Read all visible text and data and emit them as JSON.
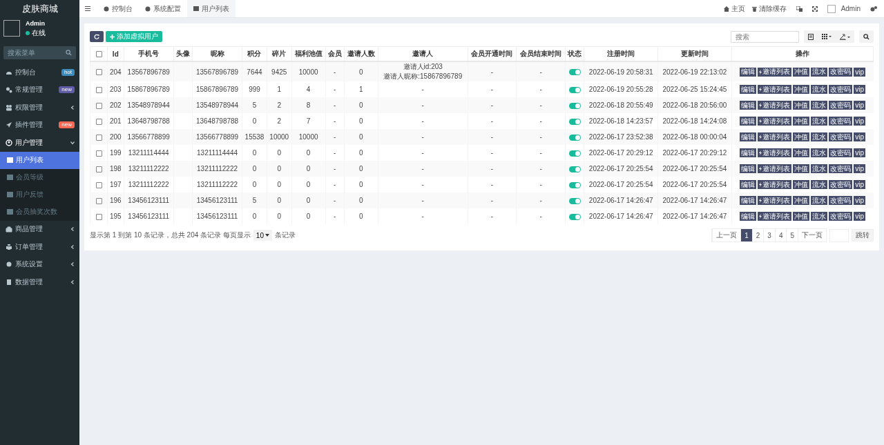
{
  "sidebar": {
    "brand": "皮肤商城",
    "user": {
      "name": "Admin",
      "status": "在线"
    },
    "search": {
      "placeholder": "搜索菜单"
    },
    "items": [
      {
        "label": "控制台",
        "badge": {
          "text": "hot",
          "color": "#3c8dbc"
        }
      },
      {
        "label": "常规管理",
        "badge": {
          "text": "new",
          "color": "#605ca8"
        }
      },
      {
        "label": "权限管理",
        "expanded": false
      },
      {
        "label": "插件管理",
        "badge": {
          "text": "new",
          "color": "#f56954"
        }
      },
      {
        "label": "用户管理",
        "expanded": true,
        "children": [
          {
            "label": "用户列表",
            "selected": true
          },
          {
            "label": "会员等级",
            "selected": false
          },
          {
            "label": "用户反馈",
            "selected": false
          },
          {
            "label": "会员抽奖次数",
            "selected": false
          }
        ]
      },
      {
        "label": "商品管理",
        "expanded": false
      },
      {
        "label": "订单管理",
        "expanded": false
      },
      {
        "label": "系统设置",
        "expanded": false
      },
      {
        "label": "数据管理",
        "expanded": false
      }
    ]
  },
  "header": {
    "tabs": [
      {
        "label": "控制台",
        "selected": false
      },
      {
        "label": "系统配置",
        "selected": false
      },
      {
        "label": "用户列表",
        "selected": true
      }
    ],
    "home": "主页",
    "clear_cache": "清除缓存",
    "user": "Admin"
  },
  "toolbar": {
    "add_button": "添加虚拟用户",
    "search": {
      "placeholder": "搜索"
    }
  },
  "table": {
    "columns": [
      "Id",
      "手机号",
      "头像",
      "昵称",
      "积分",
      "碎片",
      "福利池值",
      "会员",
      "邀请人数",
      "邀请人",
      "会员开通时间",
      "会员结束时间",
      "状态",
      "注册时间",
      "更新时间",
      "操作"
    ],
    "select_all_checked": false,
    "rows": [
      {
        "checked": false,
        "id": "204",
        "phone": "13567896789",
        "nickname": "13567896789",
        "points": "7644",
        "fragments": "9425",
        "pool": "10000",
        "member": "-",
        "invites": "0",
        "inviter": [
          "邀请人id:203",
          "邀请人昵称:15867896789"
        ],
        "member_start": "-",
        "member_end": "-",
        "enabled": true,
        "registered": "2022-06-19 20:58:31",
        "updated": "2022-06-19 22:13:02",
        "actions": [
          "编辑",
          "邀请列表",
          "冲值",
          "流水",
          "改密码",
          "vip"
        ]
      },
      {
        "checked": false,
        "id": "203",
        "phone": "15867896789",
        "nickname": "15867896789",
        "points": "999",
        "fragments": "1",
        "pool": "4",
        "member": "-",
        "invites": "1",
        "inviter": [
          "-"
        ],
        "member_start": "-",
        "member_end": "-",
        "enabled": true,
        "registered": "2022-06-19 20:55:28",
        "updated": "2022-06-25 15:24:45",
        "actions": [
          "编辑",
          "邀请列表",
          "冲值",
          "流水",
          "改密码",
          "vip"
        ]
      },
      {
        "checked": false,
        "id": "202",
        "phone": "13548978944",
        "nickname": "13548978944",
        "points": "5",
        "fragments": "2",
        "pool": "8",
        "member": "-",
        "invites": "0",
        "inviter": [
          "-"
        ],
        "member_start": "-",
        "member_end": "-",
        "enabled": true,
        "registered": "2022-06-18 20:55:49",
        "updated": "2022-06-18 20:56:00",
        "actions": [
          "编辑",
          "邀请列表",
          "冲值",
          "流水",
          "改密码",
          "vip"
        ]
      },
      {
        "checked": false,
        "id": "201",
        "phone": "13648798788",
        "nickname": "13648798788",
        "points": "0",
        "fragments": "2",
        "pool": "7",
        "member": "-",
        "invites": "0",
        "inviter": [
          "-"
        ],
        "member_start": "-",
        "member_end": "-",
        "enabled": true,
        "registered": "2022-06-18 14:23:57",
        "updated": "2022-06-18 14:24:08",
        "actions": [
          "编辑",
          "邀请列表",
          "冲值",
          "流水",
          "改密码",
          "vip"
        ]
      },
      {
        "checked": false,
        "id": "200",
        "phone": "13566778899",
        "nickname": "13566778899",
        "points": "15538",
        "fragments": "10000",
        "pool": "10000",
        "member": "-",
        "invites": "0",
        "inviter": [
          "-"
        ],
        "member_start": "-",
        "member_end": "-",
        "enabled": true,
        "registered": "2022-06-17 23:52:38",
        "updated": "2022-06-18 00:00:04",
        "actions": [
          "编辑",
          "邀请列表",
          "冲值",
          "流水",
          "改密码",
          "vip"
        ]
      },
      {
        "checked": false,
        "id": "199",
        "phone": "13211114444",
        "nickname": "13211114444",
        "points": "0",
        "fragments": "0",
        "pool": "0",
        "member": "-",
        "invites": "0",
        "inviter": [
          "-"
        ],
        "member_start": "-",
        "member_end": "-",
        "enabled": true,
        "registered": "2022-06-17 20:29:12",
        "updated": "2022-06-17 20:29:12",
        "actions": [
          "编辑",
          "邀请列表",
          "冲值",
          "流水",
          "改密码",
          "vip"
        ]
      },
      {
        "checked": false,
        "id": "198",
        "phone": "13211112222",
        "nickname": "13211112222",
        "points": "0",
        "fragments": "0",
        "pool": "0",
        "member": "-",
        "invites": "0",
        "inviter": [
          "-"
        ],
        "member_start": "-",
        "member_end": "-",
        "enabled": true,
        "registered": "2022-06-17 20:25:54",
        "updated": "2022-06-17 20:25:54",
        "actions": [
          "编辑",
          "邀请列表",
          "冲值",
          "流水",
          "改密码",
          "vip"
        ]
      },
      {
        "checked": false,
        "id": "197",
        "phone": "13211112222",
        "nickname": "13211112222",
        "points": "0",
        "fragments": "0",
        "pool": "0",
        "member": "-",
        "invites": "0",
        "inviter": [
          "-"
        ],
        "member_start": "-",
        "member_end": "-",
        "enabled": true,
        "registered": "2022-06-17 20:25:54",
        "updated": "2022-06-17 20:25:54",
        "actions": [
          "编辑",
          "邀请列表",
          "冲值",
          "流水",
          "改密码",
          "vip"
        ]
      },
      {
        "checked": false,
        "id": "196",
        "phone": "13456123111",
        "nickname": "13456123111",
        "points": "5",
        "fragments": "0",
        "pool": "0",
        "member": "-",
        "invites": "0",
        "inviter": [
          "-"
        ],
        "member_start": "-",
        "member_end": "-",
        "enabled": true,
        "registered": "2022-06-17 14:26:47",
        "updated": "2022-06-17 14:26:47",
        "actions": [
          "编辑",
          "邀请列表",
          "冲值",
          "流水",
          "改密码",
          "vip"
        ]
      },
      {
        "checked": false,
        "id": "195",
        "phone": "13456123111",
        "nickname": "13456123111",
        "points": "0",
        "fragments": "0",
        "pool": "0",
        "member": "-",
        "invites": "0",
        "inviter": [
          "-"
        ],
        "member_start": "-",
        "member_end": "-",
        "enabled": true,
        "registered": "2022-06-17 14:26:47",
        "updated": "2022-06-17 14:26:47",
        "actions": [
          "编辑",
          "邀请列表",
          "冲值",
          "流水",
          "改密码",
          "vip"
        ]
      }
    ]
  },
  "footer": {
    "summary": "显示第 1 到第 10 条记录，总共 204 条记录 每页显示",
    "page_size": "10",
    "page_size_suffix": "条记录",
    "pagination": {
      "prev": "上一页",
      "pages": [
        {
          "label": "1",
          "selected": true
        },
        {
          "label": "2",
          "selected": false
        },
        {
          "label": "3",
          "selected": false
        },
        {
          "label": "4",
          "selected": false
        },
        {
          "label": "5",
          "selected": false
        }
      ],
      "next": "下一页",
      "jump": "跳转"
    }
  }
}
